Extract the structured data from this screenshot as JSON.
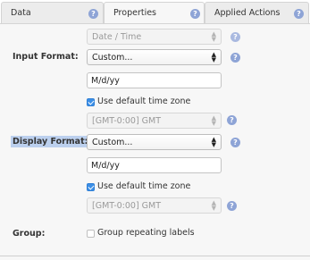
{
  "tabs": [
    {
      "label": "Data",
      "active": false
    },
    {
      "label": "Properties",
      "active": true
    },
    {
      "label": "Applied Actions",
      "active": false
    }
  ],
  "help_glyph": "?",
  "form": {
    "type_select": {
      "value": "Date / Time",
      "disabled": true
    },
    "input_format": {
      "label": "Input Format:",
      "select_value": "Custom...",
      "text_value": "M/d/yy",
      "use_default_tz_label": "Use default time zone",
      "use_default_tz_checked": true,
      "timezone_value": "[GMT-0:00] GMT"
    },
    "display_format": {
      "label": "Display Format:",
      "select_value": "Custom...",
      "text_value": "M/d/yy",
      "use_default_tz_label": "Use default time zone",
      "use_default_tz_checked": true,
      "timezone_value": "[GMT-0:00] GMT"
    },
    "group": {
      "label": "Group:",
      "checkbox_label": "Group repeating labels",
      "checked": false
    }
  },
  "colors": {
    "help_icon": "#8ea4d6",
    "checkbox_checked": "#3c8fe6",
    "label_highlight": "#bcd0ee",
    "panel_bg": "#f7f7f7"
  }
}
